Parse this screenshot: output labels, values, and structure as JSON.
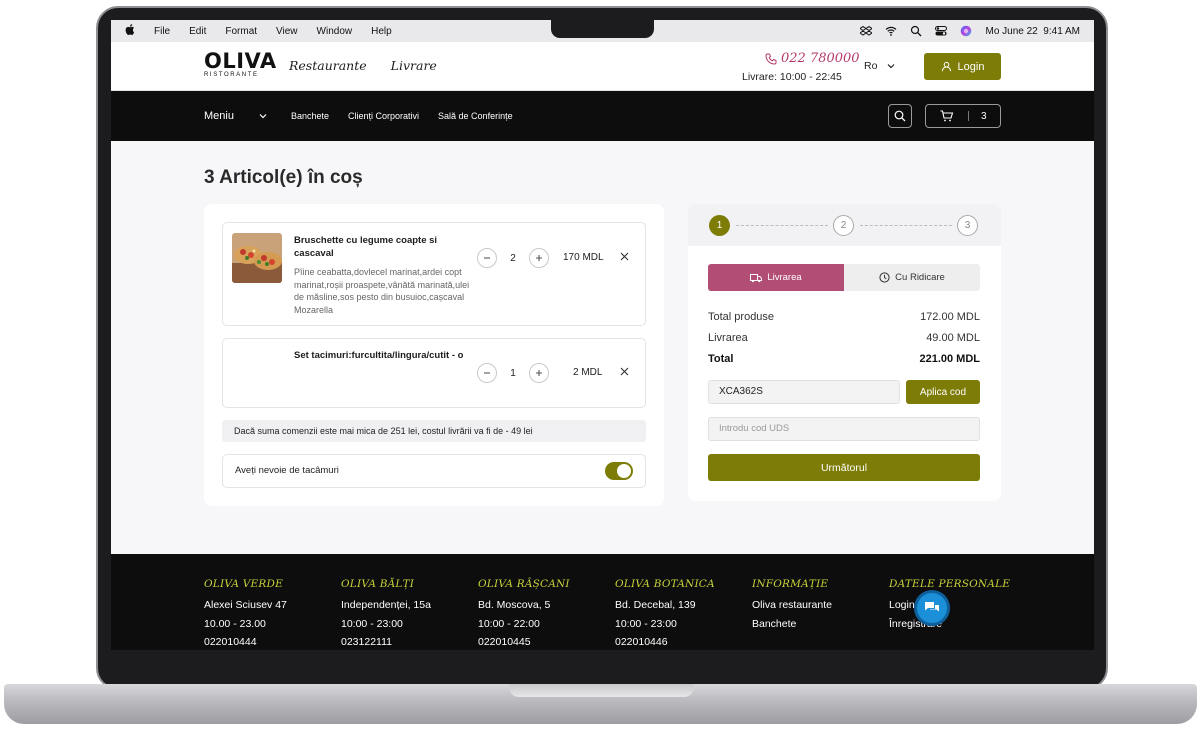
{
  "menubar": {
    "items": [
      "File",
      "Edit",
      "Format",
      "View",
      "Window",
      "Help"
    ],
    "datetime": "Mo June 22  9:41 AM"
  },
  "header": {
    "logo": "OLIVA",
    "logo_sub": "RISTORANTE",
    "nav": [
      "Restaurante",
      "Livrare"
    ],
    "phone": "022 780000",
    "hours": "Livrare: 10:00 - 22:45",
    "language": "Ro",
    "login_label": "Login"
  },
  "subnav": {
    "menu_label": "Meniu",
    "items": [
      "Banchete",
      "Clienți Corporativi",
      "Sală de Conferințe"
    ],
    "cart_count": "3"
  },
  "cart": {
    "title": "3 Articol(e) în coș",
    "items": [
      {
        "name": "Bruschette cu legume coapte si cascaval",
        "description": "Pîine ceabatta,dovlecel marinat,ardei copt marinat,roșii proaspete,vânătă marinată,ulei de măsline,sos pesto din busuioc,cașcaval Mozarella",
        "qty": "2",
        "price": "170 MDL"
      },
      {
        "name": "Set tacimuri:furcultita/lingura/cutit - o",
        "description": "",
        "qty": "1",
        "price": "2 MDL"
      }
    ],
    "delivery_note": "Dacă suma comenzii este mai mica de 251 lei, costul livrării va fi de - 49 lei",
    "cutlery_label": "Aveți nevoie de tacâmuri",
    "cutlery_on": true
  },
  "summary": {
    "steps": [
      "1",
      "2",
      "3"
    ],
    "active_step": 1,
    "tab_delivery": "Livrarea",
    "tab_pickup": "Cu Ridicare",
    "rows": [
      {
        "label": "Total produse",
        "value": "172.00 MDL"
      },
      {
        "label": "Livrarea",
        "value": "49.00 MDL"
      },
      {
        "label": "Total",
        "value": "221.00 MDL"
      }
    ],
    "promo_value": "XCA362S",
    "apply_label": "Aplica cod",
    "uds_placeholder": "Introdu cod UDS",
    "next_label": "Următorul"
  },
  "footer": {
    "columns": [
      {
        "heading": "OLIVA VERDE",
        "lines": [
          "Alexei Sciusev 47",
          "10.00 - 23.00",
          "022010444"
        ]
      },
      {
        "heading": "OLIVA BĂLȚI",
        "lines": [
          "Independenței, 15a",
          "10:00 - 23:00",
          "023122111"
        ]
      },
      {
        "heading": "OLIVA RÂȘCANI",
        "lines": [
          "Bd. Moscova, 5",
          "10:00 - 22:00",
          "022010445"
        ]
      },
      {
        "heading": "OLIVA BOTANICA",
        "lines": [
          "Bd. Decebal, 139",
          "10:00 - 23:00",
          "022010446"
        ]
      },
      {
        "heading": "INFORMAȚIE",
        "lines": [
          "Oliva restaurante",
          "Banchete"
        ]
      },
      {
        "heading": "DATELE PERSONALE",
        "lines": [
          "Login",
          "Înregistrare"
        ]
      }
    ]
  },
  "colors": {
    "accent_olive": "#7c7c07",
    "accent_pink": "#b24d75",
    "footer_heading": "#c8d23a",
    "chat_button": "#1b8fd8"
  }
}
